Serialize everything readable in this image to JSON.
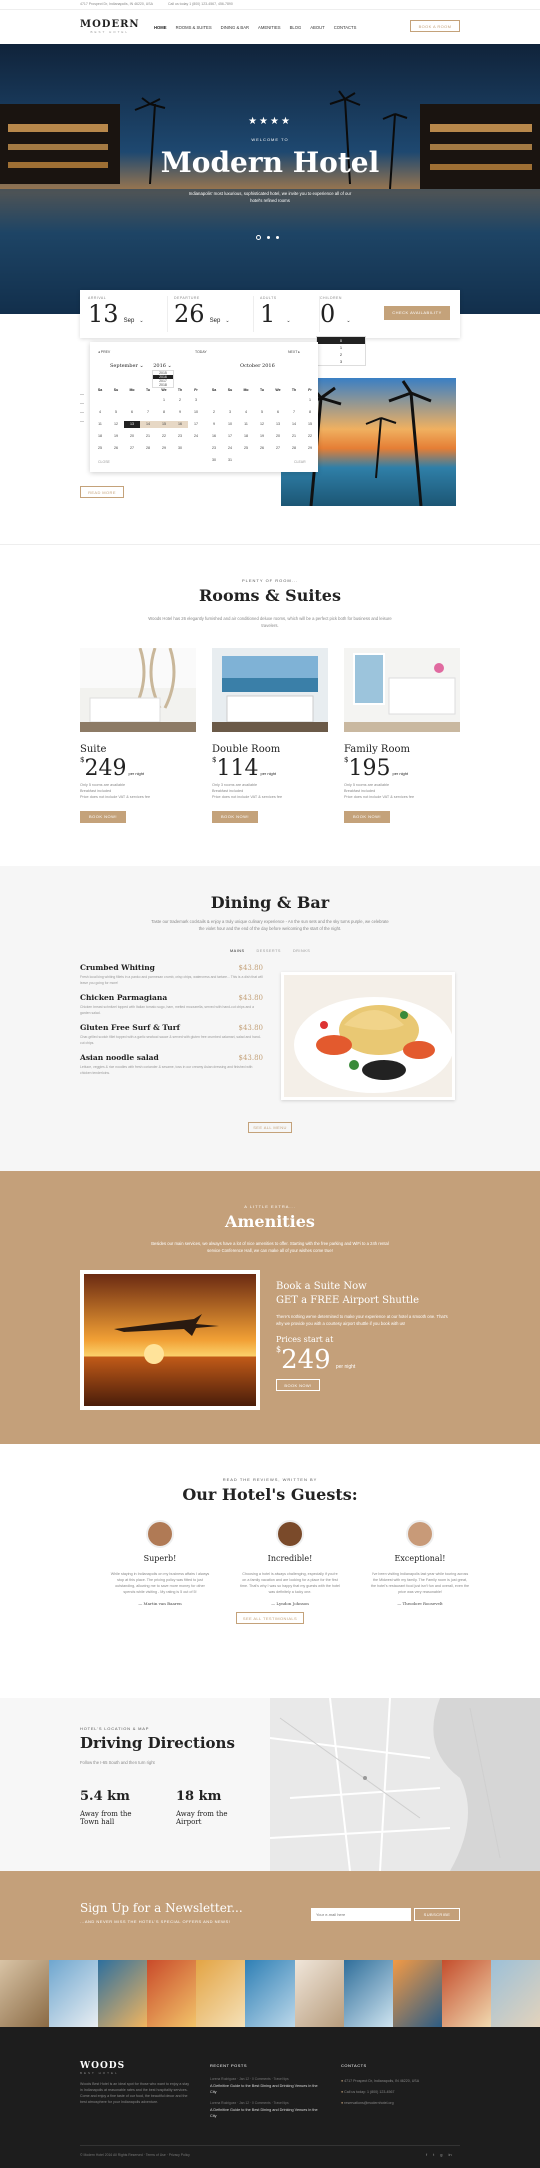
{
  "topbar": {
    "address": "4717 Prospect Dr, Indianapolis, IN 46220, USA",
    "phone": "Call us today 1 (800) 123-4567, 456-7890"
  },
  "header": {
    "logo": "MODERN",
    "logo_sub": "BEST HOTEL",
    "nav": [
      "HOME",
      "ROOMS & SUITES",
      "DINING & BAR",
      "AMENITIES",
      "BLOG",
      "ABOUT",
      "CONTACTS"
    ],
    "cta": "BOOK A ROOM"
  },
  "hero": {
    "stars": "★★★★",
    "kicker": "WELCOME TO",
    "title": "Modern Hotel",
    "text": "Indianapolis' most luxurious, sophisticated hotel, we invite you to experience all of our hotel's refined rooms"
  },
  "booking": {
    "arrival_label": "ARRIVAL",
    "arrival_day": "13",
    "arrival_mon": "Sep",
    "departure_label": "DEPARTURE",
    "departure_day": "26",
    "departure_mon": "Sep",
    "adults_label": "ADULTS",
    "adults": "1",
    "children_label": "CHILDREN",
    "children": "0",
    "children_options": [
      "0",
      "1",
      "2",
      "3"
    ],
    "button": "CHECK AVAILABILITY"
  },
  "calendar": {
    "prev": "◂ PREV",
    "today": "TODAY",
    "next": "NEXT ▸",
    "left_title": "September",
    "left_year": "2016",
    "right_title": "October 2016",
    "weekdays": [
      "Sa",
      "Su",
      "Mo",
      "Tu",
      "We",
      "Th",
      "Fr"
    ],
    "years": [
      "2015",
      "2016",
      "2017",
      "2018"
    ],
    "left_days": [
      [
        "",
        "",
        "",
        "",
        "1",
        "2",
        "3"
      ],
      [
        "4",
        "5",
        "6",
        "7",
        "8",
        "9",
        "10"
      ],
      [
        "11",
        "12",
        "13",
        "14",
        "15",
        "16",
        "17"
      ],
      [
        "18",
        "19",
        "20",
        "21",
        "22",
        "23",
        "24"
      ],
      [
        "25",
        "26",
        "27",
        "28",
        "29",
        "30",
        ""
      ]
    ],
    "right_days": [
      [
        "",
        "",
        "",
        "",
        "",
        "",
        "1"
      ],
      [
        "2",
        "3",
        "4",
        "5",
        "6",
        "7",
        "8"
      ],
      [
        "9",
        "10",
        "11",
        "12",
        "13",
        "14",
        "15"
      ],
      [
        "16",
        "17",
        "18",
        "19",
        "20",
        "21",
        "22"
      ],
      [
        "23",
        "24",
        "25",
        "26",
        "27",
        "28",
        "29"
      ],
      [
        "30",
        "31",
        "",
        "",
        "",
        "",
        ""
      ]
    ],
    "close": "CLOSE",
    "clear": "CLEAR",
    "about_btn": "READ MORE"
  },
  "rooms": {
    "kicker": "PLENTY OF ROOM...",
    "title": "Rooms & Suites",
    "text": "Woods Hotel has 26 elegantly furnished and air conditioned deluxe rooms, which will be a perfect pick both for business and leisure travelers.",
    "items": [
      {
        "name": "Suite",
        "price": "249",
        "per": "per night",
        "features": [
          "Only 5 rooms are available",
          "Breakfast included",
          "Price does not include VAT & services fee"
        ],
        "btn": "BOOK NOW!"
      },
      {
        "name": "Double Room",
        "price": "114",
        "per": "per night",
        "features": [
          "Only 3 rooms are available",
          "Breakfast included",
          "Price does not include VAT & services fee"
        ],
        "btn": "BOOK NOW!"
      },
      {
        "name": "Family Room",
        "price": "195",
        "per": "per night",
        "features": [
          "Only 5 rooms are available",
          "Breakfast included",
          "Price does not include VAT & services fee"
        ],
        "btn": "BOOK NOW!"
      }
    ]
  },
  "dining": {
    "title": "Dining & Bar",
    "text": "Taste our trademark cocktails & enjoy a truly unique culinary experience - An the sun sets and the sky turns purple, we celebrate the violet hour and the end of the day before welcoming the start of the night.",
    "tabs": [
      "MAINS",
      "DESSERTS",
      "DRINKS"
    ],
    "menu": [
      {
        "name": "Crumbed Whiting",
        "price": "$43.80",
        "desc": "Fresh local king whiting fillets in a panko and parmesan crumb, crisp chips, watercress and tartare... This is a dish that will leave you going for more!"
      },
      {
        "name": "Chicken Parmagiana",
        "price": "$43.80",
        "desc": "Chicken breast schnitzel topped with Italian tomato sugo, ham, melted mozzarella, served with hand-cut chips and a garden salad."
      },
      {
        "name": "Gluten Free Surf & Turf",
        "price": "$43.80",
        "desc": "Char-grilled scotch fillet topped with a garlic seafood sauce & served with gluten free crumbed calamari, salad and hand-cut chips."
      },
      {
        "name": "Asian noodle salad",
        "price": "$43.80",
        "desc": "Lettuce, veggies & rice noodles with fresh coriander & sesame, toss in our creamy Asian dressing and finished with chicken tenderloins."
      }
    ],
    "btn": "SEE ALL MENU"
  },
  "amenities": {
    "kicker": "A LITTLE EXTRA...",
    "title": "Amenities",
    "text": "Besides our main services, we always have a lot of nice amenities to offer. Starting with the free parking and WiFi to a 24h rental service Conference Hall, we can make all of your wishes come true!",
    "promo_title1": "Book a Suite Now",
    "promo_title2": "GET a FREE Airport Shuttle",
    "promo_text": "There's nothing we've determined to make your experience at our hotel a smooth one. That's why we provide you with a courtesy airport shuttle if you book with us!",
    "price_label": "Prices start at",
    "price": "249",
    "per": "per night",
    "btn": "BOOK NOW!"
  },
  "reviews": {
    "kicker": "READ THE REVIEWS, WRITTEN BY",
    "title": "Our Hotel's Guests:",
    "items": [
      {
        "title": "Superb!",
        "text": "While staying in Indianapolis on my business affairs I always stop at this place. The pricing policy was fitted to just outstanding, allowing me to save more money for other spends while visiting - My rating is 5 out of 5!",
        "author": "— Martin van Baaren"
      },
      {
        "title": "Incredible!",
        "text": "Choosing a hotel is always challenging, especially if you're on a family vacation and are looking for a place for the first time. That's why I was so happy that my guests with the hotel was definitely a lucky one.",
        "author": "— Lyndon Johnson"
      },
      {
        "title": "Exceptional!",
        "text": "I've been visiting Indianapolis last year while touring across the Midwest with my family. The Family room is just great, the hotel's restaurant food just isn't fun and overall, even the price was very reasonable!",
        "author": "— Theodore Roosevelt"
      }
    ],
    "btn": "SEE ALL TESTIMONIALS"
  },
  "directions": {
    "kicker": "HOTEL'S LOCATION & MAP",
    "title": "Driving Directions",
    "text": "Follow the I-65 South and then turn right",
    "d1": "5.4 km",
    "l1a": "Away from the",
    "l1b": "Town hall",
    "d2": "18 km",
    "l2a": "Away from the",
    "l2b": "Airport"
  },
  "newsletter": {
    "title": "Sign Up for a Newsletter...",
    "sub": "...AND NEVER MISS THE HOTEL'S SPECIAL OFFERS AND NEWS!",
    "placeholder": "Your e-mail here",
    "btn": "SUBSCRIBE"
  },
  "footer": {
    "logo": "WOODS",
    "logo_sub": "BEST HOTEL",
    "about": "Woods Best Hotel is an ideal spot for those who want to enjoy a stay in Indianapolis at reasonable rates and the best hospitality services. Come and enjoy a fine taste of our food, the beautiful decor and the best atmosphere for your Indianapolis adventure.",
    "posts_title": "RECENT POSTS",
    "posts": [
      {
        "meta": "Lorena Rodriguez · Jan 12 · 0 Comments · Travel tips",
        "title": "A Definitive Guide to the Best Dining and Drinking Venues in the City"
      },
      {
        "meta": "Lorena Rodriguez · Jan 12 · 0 Comments · Travel tips",
        "title": "A Definitive Guide to the Best Dining and Drinking Venues in the City"
      }
    ],
    "contacts_title": "CONTACTS",
    "contacts": [
      "4717 Prospect Dr, Indianapolis, IN 46220, USA",
      "Call us today: 1 (800) 123-4567",
      "reservations@modernhotel.org"
    ],
    "copyright": "© Modern Hotel 2016 All Rights Reserved · Terms of Use · Privacy Policy",
    "social": [
      "f",
      "t",
      "g",
      "in"
    ]
  },
  "colors": {
    "accent": "#c4a27a",
    "dark": "#1d1d1d"
  }
}
